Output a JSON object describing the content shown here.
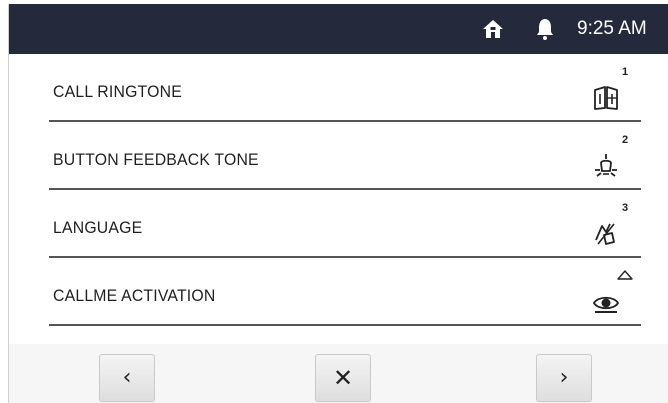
{
  "status_bar": {
    "time": "9:25 AM",
    "icons": [
      "home-icon",
      "bell-icon"
    ]
  },
  "menu": {
    "items": [
      {
        "label": "CALL RINGTONE",
        "icon": "book-icon",
        "badge": "1"
      },
      {
        "label": "BUTTON FEEDBACK TONE",
        "icon": "bulb-icon",
        "badge": "2"
      },
      {
        "label": "LANGUAGE",
        "icon": "language-icon",
        "badge": "3"
      },
      {
        "label": "CALLME ACTIVATION",
        "icon": "eye-icon",
        "badge": ""
      }
    ]
  },
  "nav": {
    "prev_label": "‹",
    "close_label": "✕",
    "next_label": "›"
  },
  "colors": {
    "status_bar_bg": "#242a3b",
    "divider": "#555555",
    "text": "#1f1f1f"
  }
}
